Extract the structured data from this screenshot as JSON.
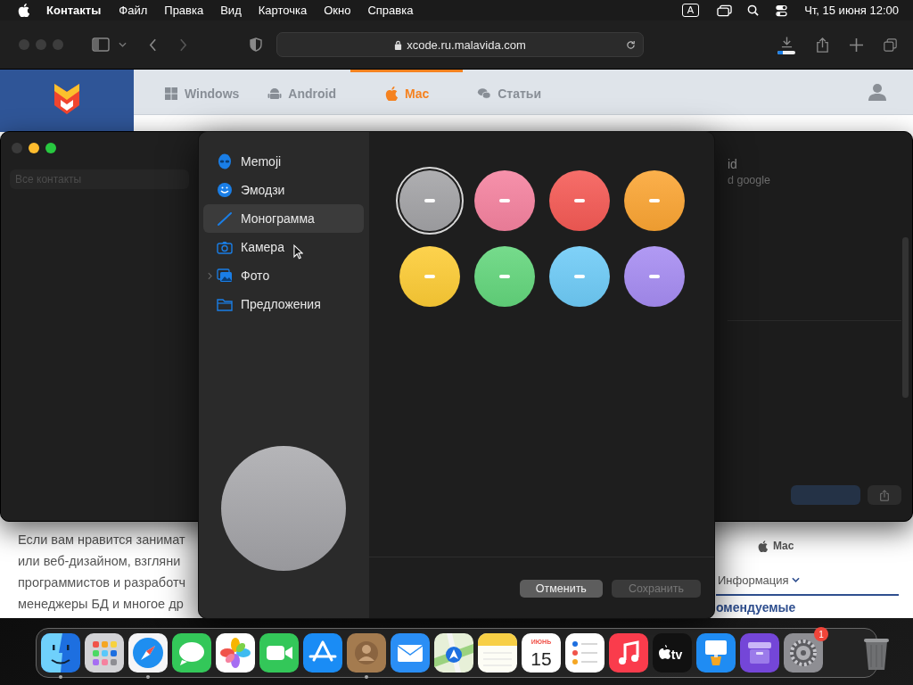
{
  "menu_bar": {
    "app_name": "Контакты",
    "menus": [
      "Файл",
      "Правка",
      "Вид",
      "Карточка",
      "Окно",
      "Справка"
    ],
    "input_source": "A",
    "clock": "Чт, 15 июня 12:00"
  },
  "browser": {
    "url": "xcode.ru.malavida.com",
    "download": {
      "level": 0.3
    }
  },
  "site": {
    "tabs": [
      {
        "label": "Windows",
        "kind": "windows",
        "selected": false
      },
      {
        "label": "Android",
        "kind": "android",
        "selected": false
      },
      {
        "label": "Mac",
        "kind": "mac",
        "selected": true
      },
      {
        "label": "Статьи",
        "kind": "articles",
        "selected": false
      }
    ],
    "paragraph_lines": [
      "Если вам нравится занимат",
      "или веб-дизайном, взгляни",
      "программистов и разработч",
      "менеджеры БД и многое др"
    ],
    "side": {
      "platform": "Mac",
      "info_link": "Информация",
      "heading": "омендуемые"
    }
  },
  "contacts_window": {
    "search_placeholder": "Все контакты",
    "fragments": [
      "id",
      "d google"
    ]
  },
  "avatar_picker": {
    "sources": [
      {
        "label": "Memoji",
        "kind": "memoji",
        "selected": false,
        "expandable": false
      },
      {
        "label": "Эмодзи",
        "kind": "emoji",
        "selected": false,
        "expandable": false
      },
      {
        "label": "Монограмма",
        "kind": "monogram",
        "selected": true,
        "expandable": false
      },
      {
        "label": "Камера",
        "kind": "camera",
        "selected": false,
        "expandable": false
      },
      {
        "label": "Фото",
        "kind": "photos",
        "selected": false,
        "expandable": true
      },
      {
        "label": "Предложения",
        "kind": "suggestions",
        "selected": false,
        "expandable": false
      }
    ],
    "colors": [
      {
        "color": "#a3a3a6",
        "selected": true
      },
      {
        "color": "#f5829f",
        "selected": false
      },
      {
        "color": "#f55a55",
        "selected": false
      },
      {
        "color": "#fba533",
        "selected": false
      },
      {
        "color": "#fdcc35",
        "selected": false
      },
      {
        "color": "#63d67c",
        "selected": false
      },
      {
        "color": "#6ecbf7",
        "selected": false
      },
      {
        "color": "#a68cf2",
        "selected": false
      }
    ],
    "buttons": [
      {
        "label": "Отменить",
        "disabled": false
      },
      {
        "label": "Сохранить",
        "disabled": true
      }
    ]
  },
  "dock": {
    "apps": [
      {
        "kind": "finder",
        "running": true
      },
      {
        "kind": "launchpad",
        "running": false
      },
      {
        "kind": "safari",
        "running": true
      },
      {
        "kind": "messages",
        "running": false
      },
      {
        "kind": "photos",
        "running": false
      },
      {
        "kind": "facetime",
        "running": false
      },
      {
        "kind": "appstore",
        "running": false
      },
      {
        "kind": "contacts",
        "running": true
      },
      {
        "kind": "mail",
        "running": false
      },
      {
        "kind": "maps",
        "running": false
      },
      {
        "kind": "notes",
        "running": false
      },
      {
        "kind": "calendar",
        "running": false,
        "month": "ИЮНЬ",
        "day": "15"
      },
      {
        "kind": "reminders",
        "running": false
      },
      {
        "kind": "music",
        "running": false
      },
      {
        "kind": "tv",
        "running": false,
        "label": "tv"
      },
      {
        "kind": "keynote",
        "running": false
      },
      {
        "kind": "box",
        "running": false
      },
      {
        "kind": "settings",
        "running": false,
        "badge": "1"
      },
      {
        "kind": "trash",
        "running": false
      }
    ]
  }
}
